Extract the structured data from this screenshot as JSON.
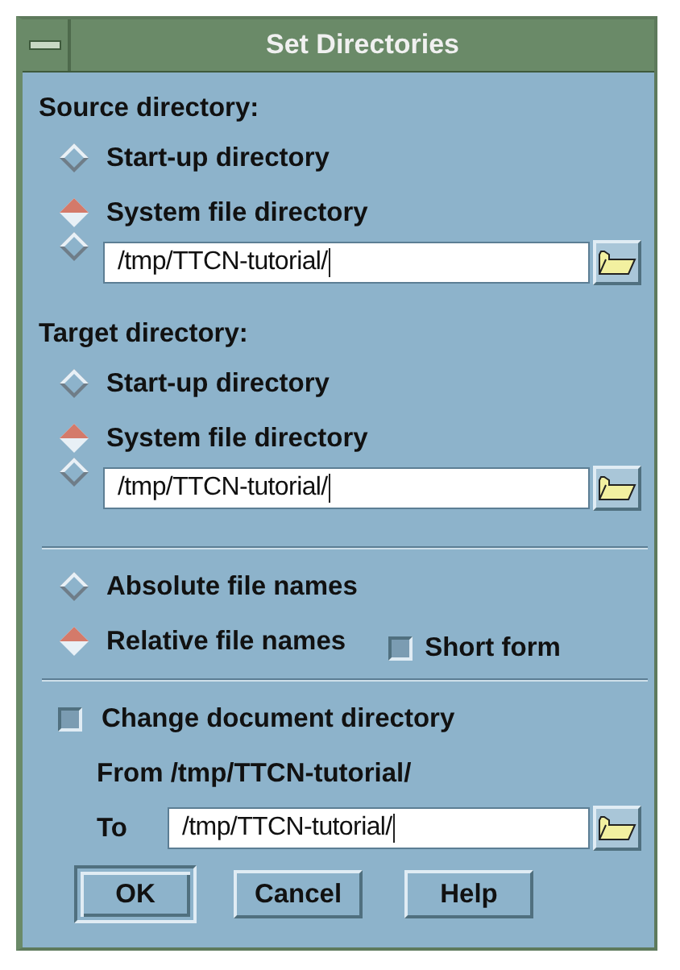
{
  "window": {
    "title": "Set Directories"
  },
  "groups": [
    {
      "label": "Source directory:",
      "options": [
        {
          "kind": "radio",
          "label": "Start-up directory",
          "selected": false
        },
        {
          "kind": "radio",
          "label": "System file directory",
          "selected": true
        },
        {
          "kind": "field",
          "value": "/tmp/TTCN-tutorial/",
          "selected": false
        }
      ]
    },
    {
      "label": "Target directory:",
      "options": [
        {
          "kind": "radio",
          "label": "Start-up directory",
          "selected": false
        },
        {
          "kind": "radio",
          "label": "System file directory",
          "selected": true
        },
        {
          "kind": "field",
          "value": "/tmp/TTCN-tutorial/",
          "selected": false
        }
      ]
    }
  ],
  "naming": {
    "options": [
      {
        "label": "Absolute file names",
        "selected": false
      },
      {
        "label": "Relative file names",
        "selected": true
      }
    ],
    "short_form": {
      "label": "Short form",
      "checked": false
    }
  },
  "change": {
    "label": "Change document directory",
    "checked": false,
    "from": "From /tmp/TTCN-tutorial/",
    "to_label": "To",
    "to_value": "/tmp/TTCN-tutorial/"
  },
  "buttons": [
    {
      "label": "OK",
      "default": true
    },
    {
      "label": "Cancel",
      "default": false
    },
    {
      "label": "Help",
      "default": false
    }
  ]
}
